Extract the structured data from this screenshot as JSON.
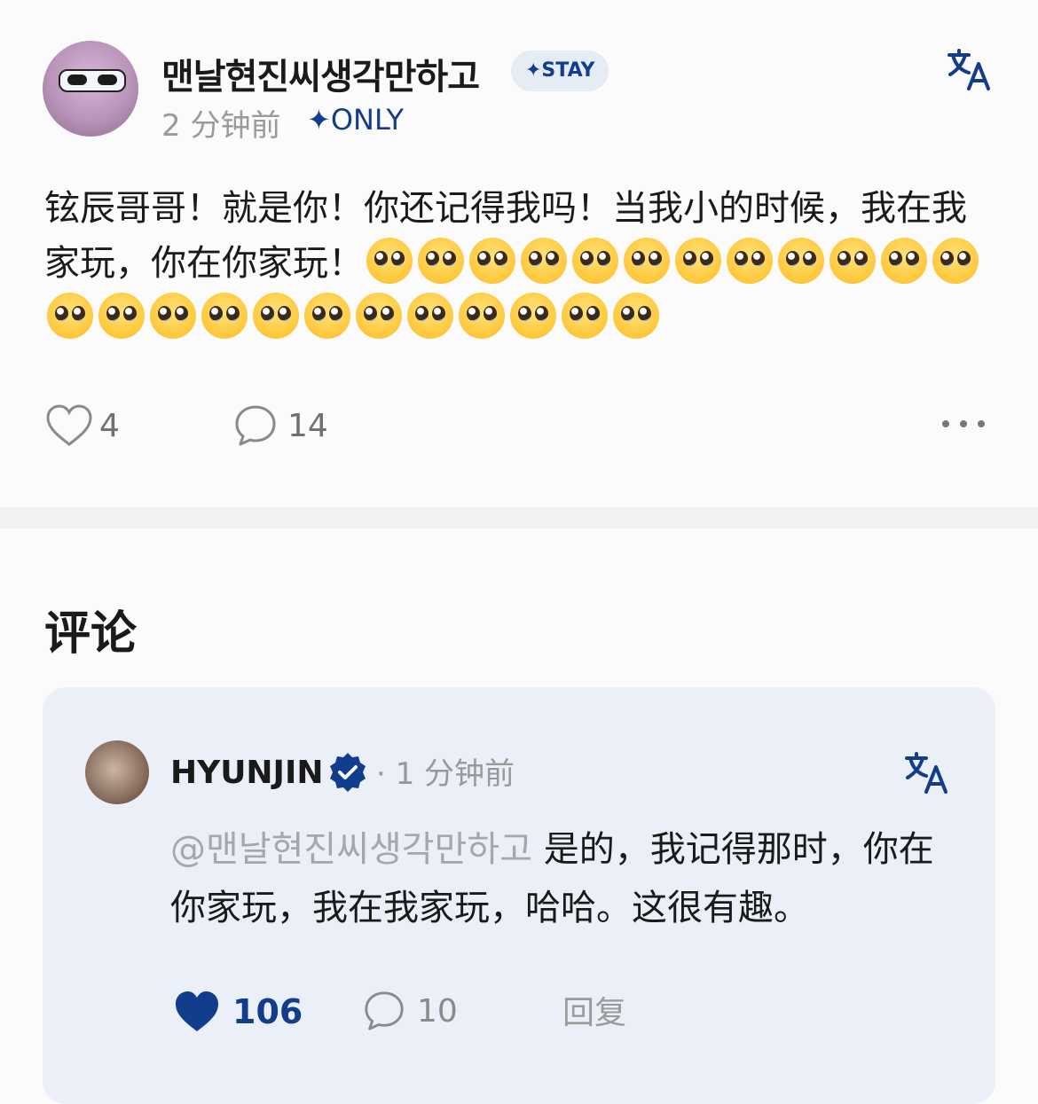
{
  "post": {
    "username": "맨날현진씨생각만하고",
    "badge": "✦STAY",
    "time": "2 分钟前",
    "audience": "✦ONLY",
    "text": "铉辰哥哥！就是你！你还记得我吗！当我小的时候，我在我家玩，你在你家玩！",
    "emoji_count": 24,
    "likes": "4",
    "comments": "14"
  },
  "comments_section": {
    "title": "评论"
  },
  "comment": {
    "author": "HYUNJIN",
    "time": "· 1 分钟前",
    "mention": "@맨날현진씨생각만하고",
    "text": " 是的，我记得那时，你在你家玩，我在我家玩，哈哈。这很有趣。",
    "likes": "106",
    "replies": "10",
    "reply_label": "回复"
  },
  "colors": {
    "accent": "#123c8c",
    "card_bg": "#ebeff7",
    "muted": "#9a9a9a"
  }
}
